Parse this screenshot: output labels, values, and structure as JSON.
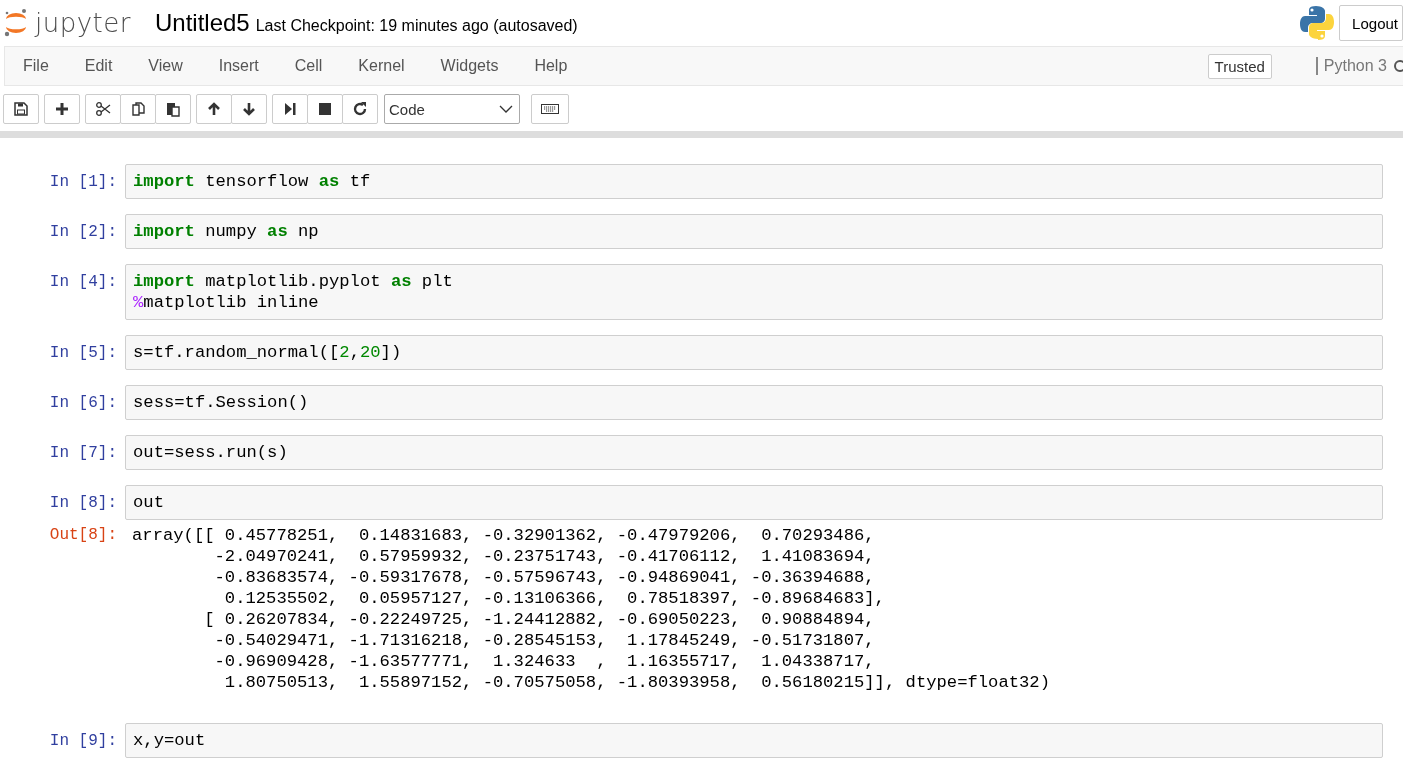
{
  "header": {
    "logo_text": "jupyter",
    "notebook_name": "Untitled5",
    "checkpoint": "Last Checkpoint: 19 minutes ago (autosaved)",
    "logout": "Logout"
  },
  "menu": {
    "items": [
      "File",
      "Edit",
      "View",
      "Insert",
      "Cell",
      "Kernel",
      "Widgets",
      "Help"
    ],
    "trusted": "Trusted",
    "kernel_name": "Python 3"
  },
  "toolbar": {
    "groups": [
      [
        {
          "kind": "save"
        }
      ],
      [
        {
          "kind": "plus"
        }
      ],
      [
        {
          "kind": "cut"
        },
        {
          "kind": "copy"
        },
        {
          "kind": "paste"
        }
      ],
      [
        {
          "kind": "up"
        },
        {
          "kind": "down"
        }
      ],
      [
        {
          "kind": "run"
        },
        {
          "kind": "stop"
        },
        {
          "kind": "restart"
        }
      ]
    ],
    "cell_type": "Code",
    "palette": {
      "kind": "keyboard"
    }
  },
  "cells": [
    {
      "prompt": "In [1]:",
      "lines": [
        [
          {
            "kind": "keyword",
            "text": "import"
          },
          {
            "kind": "plain",
            "text": " tensorflow "
          },
          {
            "kind": "keyword",
            "text": "as"
          },
          {
            "kind": "plain",
            "text": " tf"
          }
        ]
      ]
    },
    {
      "prompt": "In [2]:",
      "lines": [
        [
          {
            "kind": "keyword",
            "text": "import"
          },
          {
            "kind": "plain",
            "text": " numpy "
          },
          {
            "kind": "keyword",
            "text": "as"
          },
          {
            "kind": "plain",
            "text": " np"
          }
        ]
      ]
    },
    {
      "prompt": "In [4]:",
      "lines": [
        [
          {
            "kind": "keyword",
            "text": "import"
          },
          {
            "kind": "plain",
            "text": " matplotlib.pyplot "
          },
          {
            "kind": "keyword",
            "text": "as"
          },
          {
            "kind": "plain",
            "text": " plt"
          }
        ],
        [
          {
            "kind": "magic",
            "text": "%"
          },
          {
            "kind": "plain",
            "text": "matplotlib inline"
          }
        ]
      ]
    },
    {
      "prompt": "In [5]:",
      "lines": [
        [
          {
            "kind": "plain",
            "text": "s=tf.random_normal(["
          },
          {
            "kind": "number",
            "text": "2"
          },
          {
            "kind": "plain",
            "text": ","
          },
          {
            "kind": "number",
            "text": "20"
          },
          {
            "kind": "plain",
            "text": "])"
          }
        ]
      ]
    },
    {
      "prompt": "In [6]:",
      "lines": [
        [
          {
            "kind": "plain",
            "text": "sess=tf.Session()"
          }
        ]
      ]
    },
    {
      "prompt": "In [7]:",
      "lines": [
        [
          {
            "kind": "plain",
            "text": "out=sess.run(s)"
          }
        ]
      ]
    },
    {
      "prompt": "In [8]:",
      "lines": [
        [
          {
            "kind": "plain",
            "text": "out"
          }
        ]
      ],
      "output": {
        "prompt": "Out[8]:",
        "text": "array([[ 0.45778251,  0.14831683, -0.32901362, -0.47979206,  0.70293486,\n        -2.04970241,  0.57959932, -0.23751743, -0.41706112,  1.41083694,\n        -0.83683574, -0.59317678, -0.57596743, -0.94869041, -0.36394688,\n         0.12535502,  0.05957127, -0.13106366,  0.78518397, -0.89684683],\n       [ 0.26207834, -0.22249725, -1.24412882, -0.69050223,  0.90884894,\n        -0.54029471, -1.71316218, -0.28545153,  1.17845249, -0.51731807,\n        -0.96909428, -1.63577771,  1.324633  ,  1.16355717,  1.04338717,\n         1.80750513,  1.55897152, -0.70575058, -1.80393958,  0.56180215]], dtype=float32)"
      }
    },
    {
      "prompt": "In [9]:",
      "lines": [
        [
          {
            "kind": "plain",
            "text": "x,y=out"
          }
        ]
      ]
    }
  ]
}
